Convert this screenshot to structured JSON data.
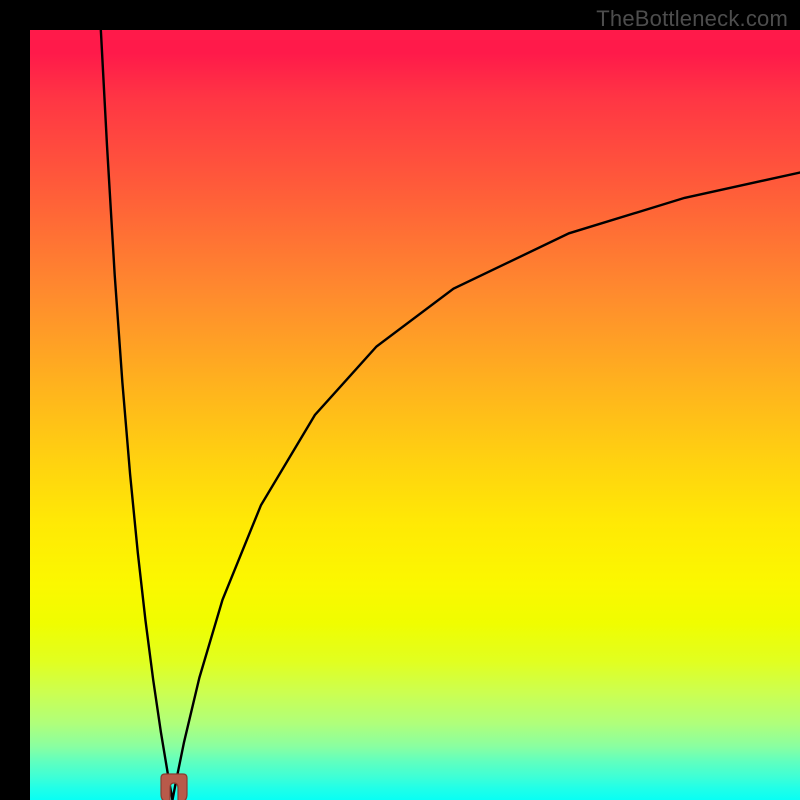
{
  "watermark": "TheBottleneck.com",
  "colors": {
    "frame": "#000000",
    "watermark_text": "#4d4d4d",
    "curve": "#000000",
    "marker_fill": "#b85a4a",
    "marker_stroke": "#8a3d32"
  },
  "chart_data": {
    "type": "line",
    "title": "",
    "xlabel": "",
    "ylabel": "",
    "xlim": [
      0,
      100
    ],
    "ylim": [
      0,
      100
    ],
    "grid": false,
    "background": "vertical-gradient red→orange→yellow→green (top→bottom)",
    "series": [
      {
        "name": "bottleneck-curve",
        "description": "V-shaped cusp curve; minimum near x≈18.5, y≈0; approx 100·|1 − 18.5/x| clamped to [0,100]",
        "x": [
          9.2,
          10,
          11,
          12,
          13,
          14,
          15,
          16,
          17,
          18,
          18.5,
          19,
          20,
          22,
          25,
          30,
          37,
          45,
          55,
          70,
          85,
          100
        ],
        "y": [
          100,
          85,
          68.2,
          54.2,
          42.3,
          32.1,
          23.3,
          15.6,
          8.8,
          2.8,
          0,
          2.6,
          7.5,
          15.9,
          26,
          38.3,
          50,
          58.9,
          66.4,
          73.6,
          78.2,
          81.5
        ]
      }
    ],
    "marker": {
      "name": "optimal-point",
      "shape": "U-notch",
      "x": 18.5,
      "y": 0
    }
  }
}
